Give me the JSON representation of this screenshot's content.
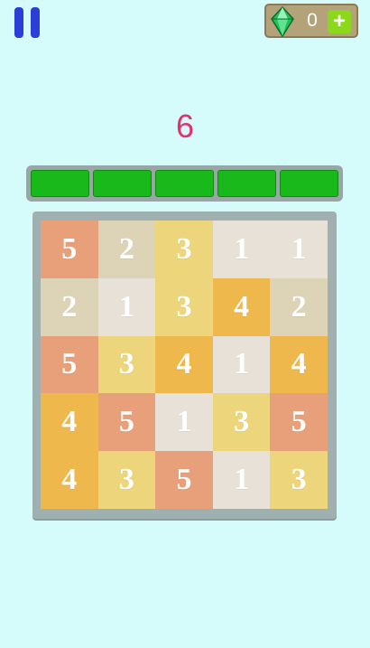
{
  "score": "6",
  "gems": {
    "count": "0",
    "add_label": "+"
  },
  "progress": {
    "segments_total": 5,
    "segments_filled": 5
  },
  "colors": {
    "background": "#d6fbfb",
    "score": "#e0336e",
    "progress_fill": "#19b81b",
    "pause_button": "#2b3fd6",
    "tile_1": "#e8e1d8",
    "tile_2": "#ddd3b6",
    "tile_3": "#ecd57a",
    "tile_4": "#eeb84c",
    "tile_5": "#e8a07a"
  },
  "icons": {
    "pause": "pause-icon",
    "gem": "gem-icon",
    "add": "plus-icon"
  },
  "board": {
    "rows": [
      [
        "5",
        "2",
        "3",
        "1",
        "1"
      ],
      [
        "2",
        "1",
        "3",
        "4",
        "2"
      ],
      [
        "5",
        "3",
        "4",
        "1",
        "4"
      ],
      [
        "4",
        "5",
        "1",
        "3",
        "5"
      ],
      [
        "4",
        "3",
        "5",
        "1",
        "3"
      ]
    ]
  }
}
